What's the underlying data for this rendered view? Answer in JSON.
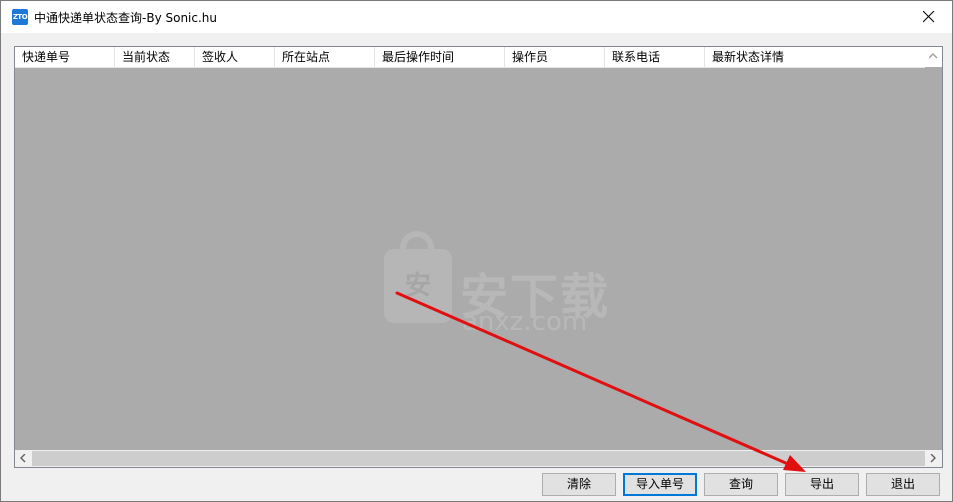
{
  "window": {
    "title": "中通快递单状态查询-By Sonic.hu",
    "app_icon_text": "ZTO"
  },
  "table": {
    "columns": [
      "快递单号",
      "当前状态",
      "签收人",
      "所在站点",
      "最后操作时间",
      "操作员",
      "联系电话",
      "最新状态详情"
    ],
    "rows": []
  },
  "watermark": {
    "badge_char": "安",
    "text": "安下载",
    "domain": "anxz.com"
  },
  "buttons": {
    "clear": "清除",
    "import": "导入单号",
    "query": "查询",
    "export": "导出",
    "exit": "退出"
  },
  "colors": {
    "list_background": "#ababab",
    "annotation_arrow": "#e01010",
    "focus_border": "#0078d7"
  }
}
